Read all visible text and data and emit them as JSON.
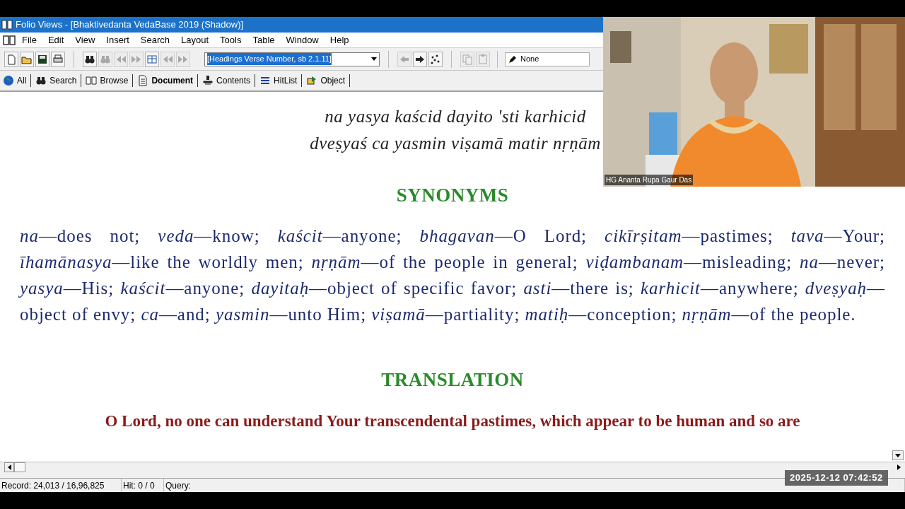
{
  "window": {
    "title": "Folio Views - [Bhaktivedanta VedaBase 2019 (Shadow)]"
  },
  "menu": [
    "File",
    "Edit",
    "View",
    "Insert",
    "Search",
    "Layout",
    "Tools",
    "Table",
    "Window",
    "Help"
  ],
  "toolbar": [
    {
      "kind": "new",
      "disabled": false
    },
    {
      "kind": "open",
      "disabled": false
    },
    {
      "kind": "save",
      "disabled": false
    },
    {
      "kind": "print",
      "disabled": false
    },
    {
      "kind": "separator"
    },
    {
      "kind": "binoculars",
      "disabled": false
    },
    {
      "kind": "binoculars",
      "disabled": true
    },
    {
      "kind": "rewind",
      "disabled": true
    },
    {
      "kind": "fastforward",
      "disabled": true
    },
    {
      "kind": "panes",
      "disabled": false
    },
    {
      "kind": "rewind",
      "disabled": true
    },
    {
      "kind": "fastforward",
      "disabled": true
    }
  ],
  "level_combo": {
    "value": "[Headings Verse Number, sb 2.1.11]",
    "highlighted": true
  },
  "toolbar_right": [
    {
      "kind": "back",
      "disabled": true
    },
    {
      "kind": "forward",
      "disabled": false
    },
    {
      "kind": "scatter",
      "disabled": false
    },
    {
      "kind": "separator"
    },
    {
      "kind": "copy",
      "disabled": true
    },
    {
      "kind": "paste",
      "disabled": true
    }
  ],
  "highlighter": {
    "value": "None"
  },
  "view_tabs": [
    {
      "label": "All",
      "kind": "globe",
      "selected": false
    },
    {
      "label": "Search",
      "kind": "binoculars",
      "selected": false
    },
    {
      "label": "Browse",
      "kind": "book",
      "selected": false
    },
    {
      "label": "Document",
      "kind": "page",
      "selected": true
    },
    {
      "label": "Contents",
      "kind": "tree",
      "selected": false
    },
    {
      "label": "HitList",
      "kind": "list",
      "selected": false
    },
    {
      "label": "Object",
      "kind": "object",
      "selected": false
    }
  ],
  "verse_lines": [
    "na yasya kaścid dayito 'sti karhicid",
    "dveṣyaś ca yasmin viṣamā matir nṛṇām"
  ],
  "synonyms_heading": "SYNONYMS",
  "synonyms": "*na*—does not; *veda*—know; *kaścit*—anyone; *bhagavan*—O Lord; *cikīrṣitam*—pastimes; *tava*—Your; *īhamānasya*—like the worldly men; *nṛṇām*—of the people in general; *viḍambanam*—misleading; *na*—never; *yasya*—His; *kaścit*—anyone; *dayitaḥ*—object of specific favor; *asti*—there is; *karhicit*—anywhere; *dveṣyaḥ*—object of envy; *ca*—and; *yasmin*—unto Him; *viṣamā*—partiality; *matiḥ*—conception; *nṛṇām*—of the people.",
  "translation_heading": "TRANSLATION",
  "translation": "O Lord, no one can understand Your transcendental pastimes, which appear to be human and so are",
  "status_bar": {
    "record": "Record: 24,013 / 16,96,825",
    "hit": "Hit: 0 / 0",
    "query": "Query:"
  },
  "video": {
    "kind": "picture",
    "caption": "HG Ananta Rupa Gaur Das"
  },
  "timestamp": "2025-12-12 07:42:52"
}
